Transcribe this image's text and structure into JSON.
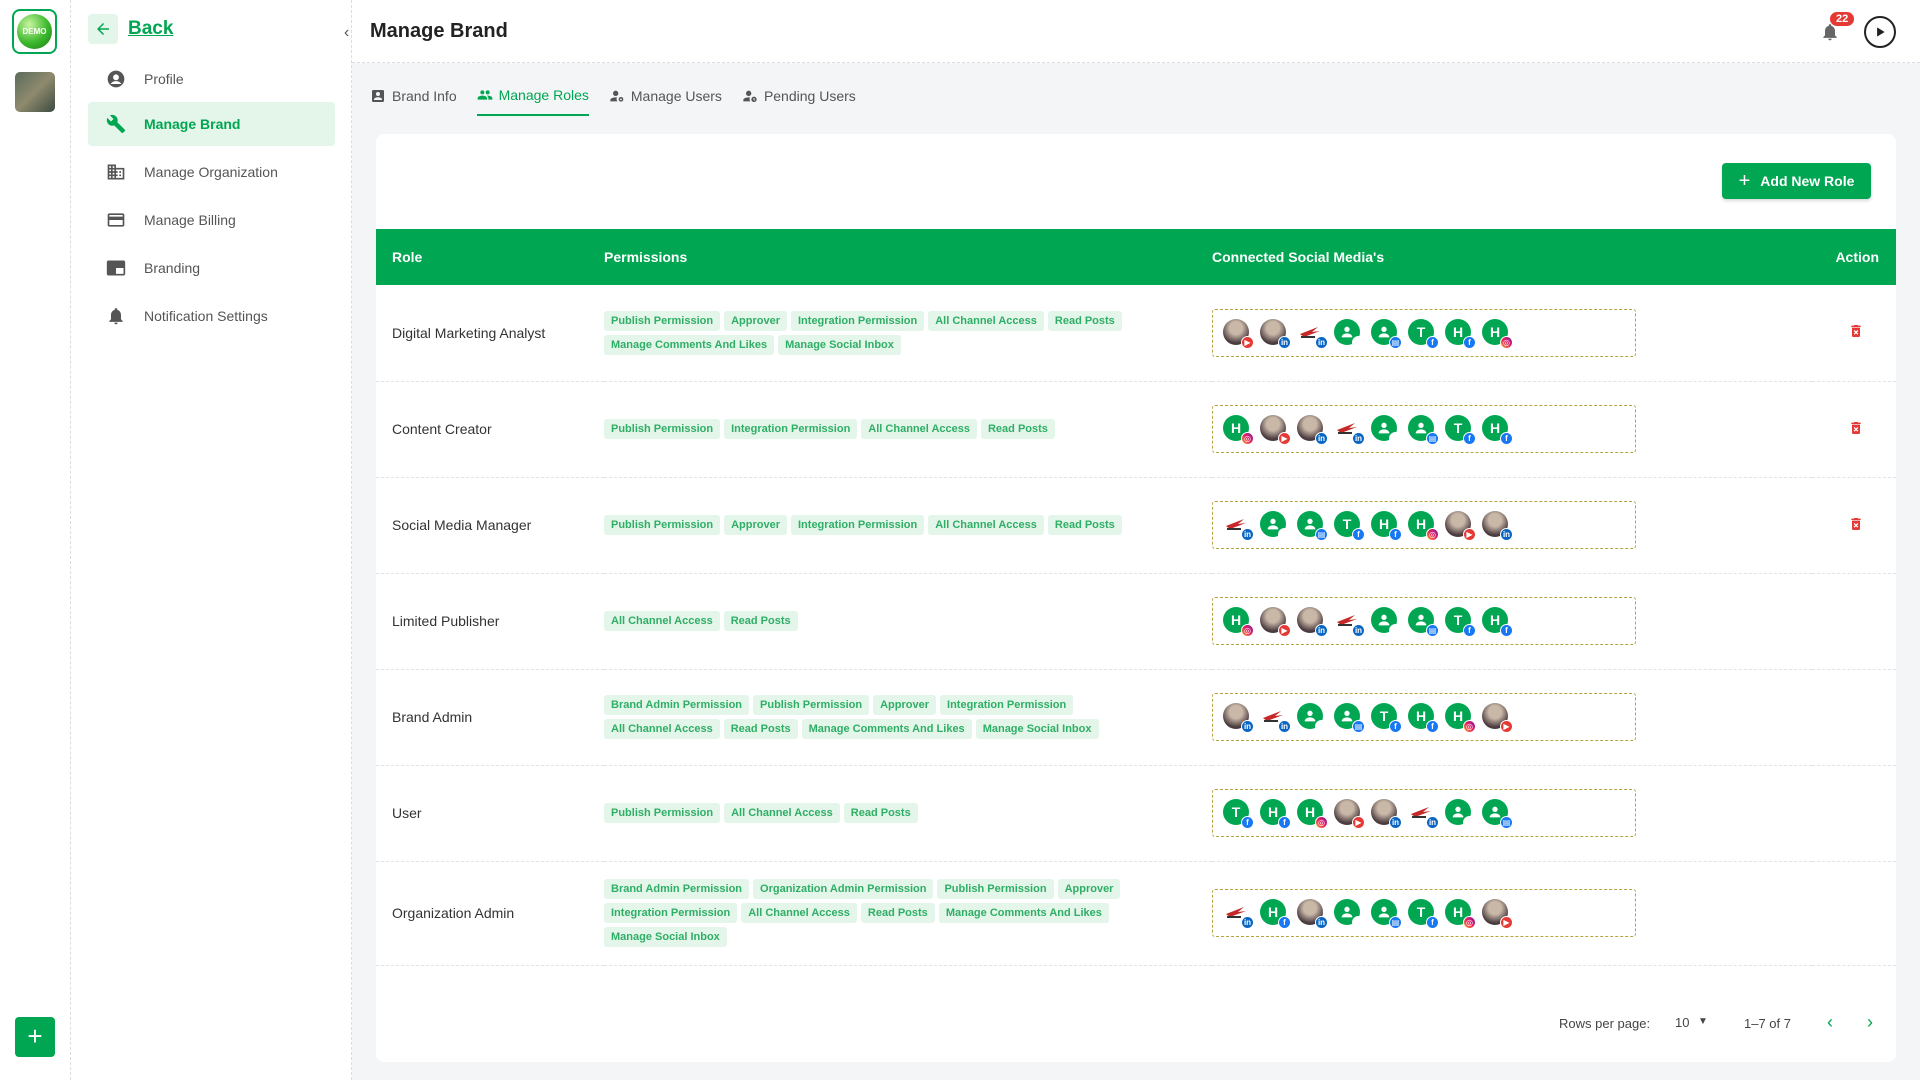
{
  "rail": {
    "logo_text": "DEMO",
    "add_label": "+"
  },
  "sidenav": {
    "back_label": "Back",
    "items": [
      {
        "label": "Profile",
        "icon": "profile-icon"
      },
      {
        "label": "Manage Brand",
        "icon": "wrench-icon",
        "active": true
      },
      {
        "label": "Manage Organization",
        "icon": "building-icon"
      },
      {
        "label": "Manage Billing",
        "icon": "card-icon"
      },
      {
        "label": "Branding",
        "icon": "branding-icon"
      },
      {
        "label": "Notification Settings",
        "icon": "bell-icon"
      }
    ]
  },
  "header": {
    "title": "Manage Brand",
    "notification_count": "22"
  },
  "tabs": [
    {
      "label": "Brand Info",
      "icon": "brand-info-icon"
    },
    {
      "label": "Manage Roles",
      "icon": "users-icon",
      "active": true
    },
    {
      "label": "Manage Users",
      "icon": "user-gear-icon"
    },
    {
      "label": "Pending Users",
      "icon": "user-pending-icon"
    }
  ],
  "add_role_label": "Add New Role",
  "table": {
    "headers": {
      "role": "Role",
      "permissions": "Permissions",
      "media": "Connected Social Media's",
      "action": "Action"
    },
    "rows": [
      {
        "role": "Digital Marketing Analyst",
        "permissions": [
          "Publish Permission",
          "Approver",
          "Integration Permission",
          "All Channel Access",
          "Read Posts",
          "Manage Comments And Likes",
          "Manage Social Inbox"
        ],
        "media": [
          [
            "W",
            "youtube"
          ],
          [
            "W",
            "linkedin"
          ],
          [
            "F",
            "linkedin"
          ],
          [
            "P",
            "x"
          ],
          [
            "P",
            "biz"
          ],
          [
            "T",
            "facebook"
          ],
          [
            "H",
            "facebook"
          ],
          [
            "H",
            "instagram"
          ]
        ],
        "deletable": true
      },
      {
        "role": "Content Creator",
        "permissions": [
          "Publish Permission",
          "Integration Permission",
          "All Channel Access",
          "Read Posts"
        ],
        "media": [
          [
            "H",
            "instagram"
          ],
          [
            "W",
            "youtube"
          ],
          [
            "W",
            "linkedin"
          ],
          [
            "F",
            "linkedin"
          ],
          [
            "P",
            "x"
          ],
          [
            "P",
            "biz"
          ],
          [
            "T",
            "facebook"
          ],
          [
            "H",
            "facebook"
          ]
        ],
        "deletable": true
      },
      {
        "role": "Social Media Manager",
        "permissions": [
          "Publish Permission",
          "Approver",
          "Integration Permission",
          "All Channel Access",
          "Read Posts"
        ],
        "media": [
          [
            "F",
            "linkedin"
          ],
          [
            "P",
            "x"
          ],
          [
            "P",
            "biz"
          ],
          [
            "T",
            "facebook"
          ],
          [
            "H",
            "facebook"
          ],
          [
            "H",
            "instagram"
          ],
          [
            "W",
            "youtube"
          ],
          [
            "W",
            "linkedin"
          ]
        ],
        "deletable": true
      },
      {
        "role": "Limited Publisher",
        "permissions": [
          "All Channel Access",
          "Read Posts"
        ],
        "media": [
          [
            "H",
            "instagram"
          ],
          [
            "W",
            "youtube"
          ],
          [
            "W",
            "linkedin"
          ],
          [
            "F",
            "linkedin"
          ],
          [
            "P",
            "x"
          ],
          [
            "P",
            "biz"
          ],
          [
            "T",
            "facebook"
          ],
          [
            "H",
            "facebook"
          ]
        ],
        "deletable": false
      },
      {
        "role": "Brand Admin",
        "permissions": [
          "Brand Admin Permission",
          "Publish Permission",
          "Approver",
          "Integration Permission",
          "All Channel Access",
          "Read Posts",
          "Manage Comments And Likes",
          "Manage Social Inbox"
        ],
        "media": [
          [
            "W",
            "linkedin"
          ],
          [
            "F",
            "linkedin"
          ],
          [
            "P",
            "x"
          ],
          [
            "P",
            "biz"
          ],
          [
            "T",
            "facebook"
          ],
          [
            "H",
            "facebook"
          ],
          [
            "H",
            "instagram"
          ],
          [
            "W",
            "youtube"
          ]
        ],
        "deletable": false
      },
      {
        "role": "User",
        "permissions": [
          "Publish Permission",
          "All Channel Access",
          "Read Posts"
        ],
        "media": [
          [
            "T",
            "facebook"
          ],
          [
            "H",
            "facebook"
          ],
          [
            "H",
            "instagram"
          ],
          [
            "W",
            "youtube"
          ],
          [
            "W",
            "linkedin"
          ],
          [
            "F",
            "linkedin"
          ],
          [
            "P",
            "x"
          ],
          [
            "P",
            "biz"
          ]
        ],
        "deletable": false
      },
      {
        "role": "Organization Admin",
        "permissions": [
          "Brand Admin Permission",
          "Organization Admin Permission",
          "Publish Permission",
          "Approver",
          "Integration Permission",
          "All Channel Access",
          "Read Posts",
          "Manage Comments And Likes",
          "Manage Social Inbox"
        ],
        "media": [
          [
            "F",
            "linkedin"
          ],
          [
            "H",
            "facebook"
          ],
          [
            "W",
            "linkedin"
          ],
          [
            "P",
            "x"
          ],
          [
            "P",
            "biz"
          ],
          [
            "T",
            "facebook"
          ],
          [
            "H",
            "instagram"
          ],
          [
            "W",
            "youtube"
          ]
        ],
        "deletable": false
      }
    ]
  },
  "pagination": {
    "rows_per_page_label": "Rows per page:",
    "rows_per_page": "10",
    "range": "1–7 of 7"
  },
  "colors": {
    "accent": "#00a651",
    "accent_light": "#e4f6ea",
    "danger": "#e53935"
  }
}
